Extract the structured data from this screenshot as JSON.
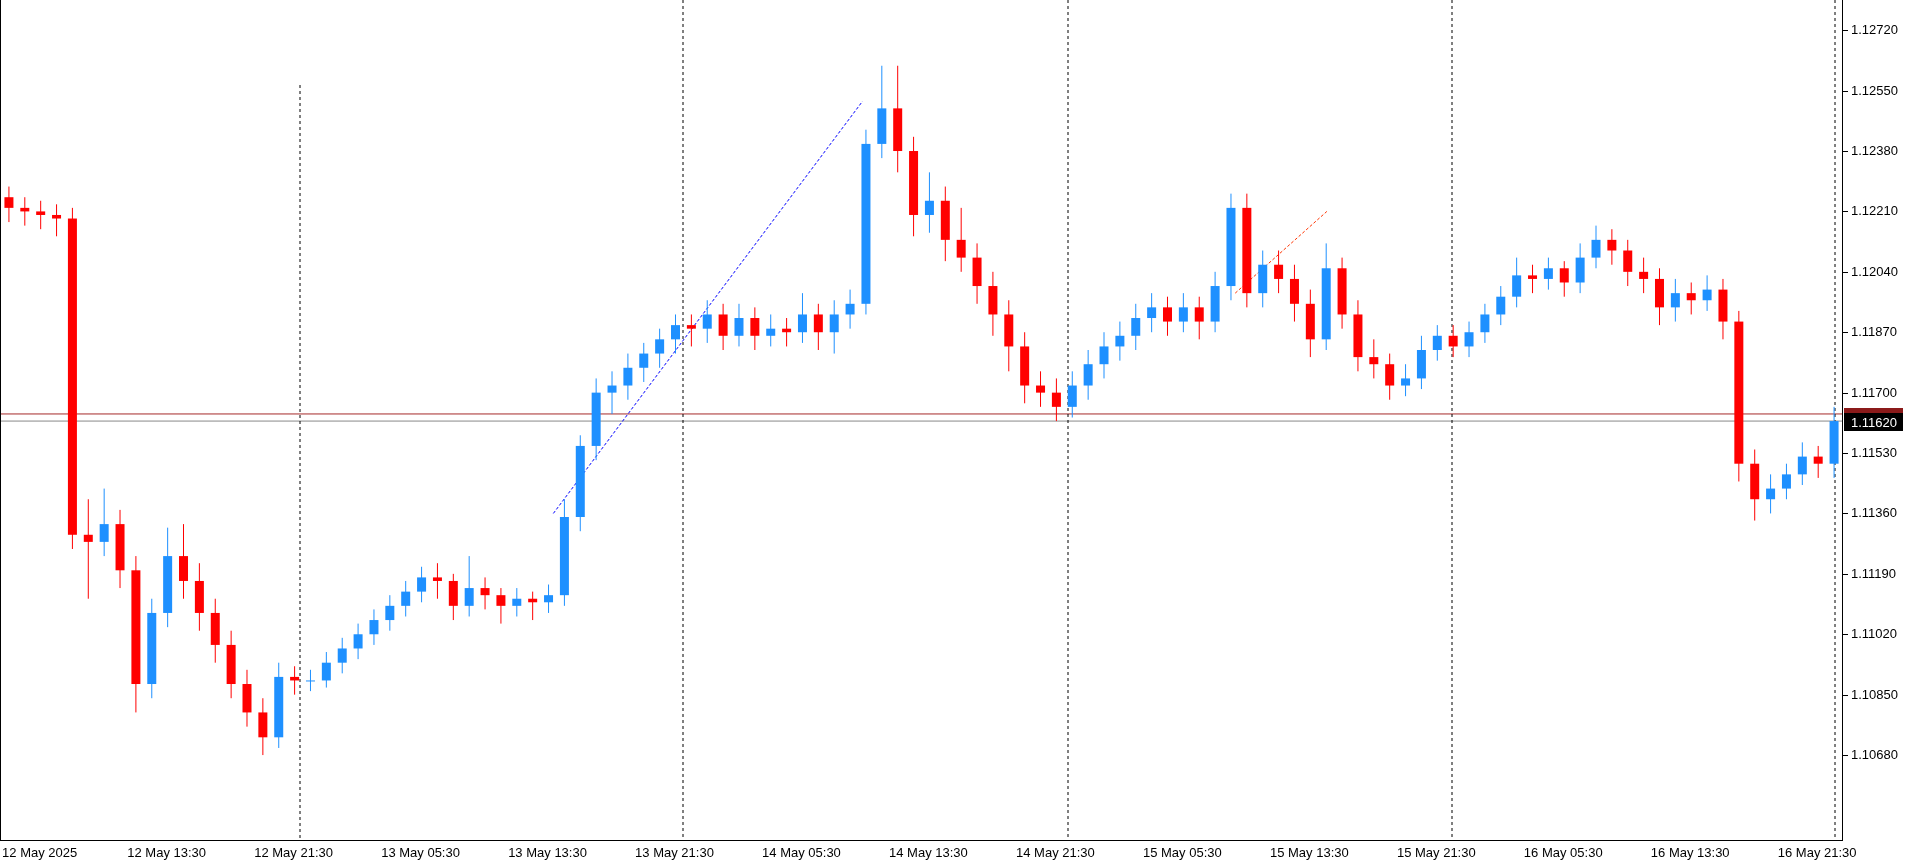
{
  "chart_data": {
    "type": "candlestick",
    "ylim": [
      1.10441,
      1.12805
    ],
    "categories": [
      null,
      null,
      "12 May 2025",
      null,
      null,
      null,
      null,
      null,
      null,
      null,
      "12 May 13:30",
      null,
      null,
      null,
      null,
      null,
      null,
      null,
      "12 May 21:30",
      null,
      null,
      null,
      null,
      null,
      null,
      null,
      "13 May 05:30",
      null,
      null,
      null,
      null,
      null,
      null,
      null,
      "13 May 13:30",
      null,
      null,
      null,
      null,
      null,
      null,
      null,
      "13 May 21:30",
      null,
      null,
      null,
      null,
      null,
      null,
      null,
      "14 May 05:30",
      null,
      null,
      null,
      null,
      null,
      null,
      null,
      "14 May 13:30",
      null,
      null,
      null,
      null,
      null,
      null,
      null,
      "14 May 21:30",
      null,
      null,
      null,
      null,
      null,
      null,
      null,
      "15 May 05:30",
      null,
      null,
      null,
      null,
      null,
      null,
      null,
      "15 May 13:30",
      null,
      null,
      null,
      null,
      null,
      null,
      null,
      "15 May 21:30",
      null,
      null,
      null,
      null,
      null,
      null,
      null,
      "16 May 05:30",
      null,
      null,
      null,
      null,
      null,
      null,
      null,
      "16 May 13:30",
      null,
      null,
      null,
      null,
      null,
      null,
      null,
      "16 May 21:30",
      null
    ],
    "ohlc": [
      [
        1.1225,
        1.1228,
        1.1218,
        1.1222
      ],
      [
        1.1222,
        1.1225,
        1.1217,
        1.1221
      ],
      [
        1.1221,
        1.1224,
        1.1216,
        1.122
      ],
      [
        1.122,
        1.1223,
        1.1214,
        1.1219
      ],
      [
        1.1219,
        1.1222,
        1.1126,
        1.113
      ],
      [
        1.113,
        1.114,
        1.1112,
        1.1128
      ],
      [
        1.1128,
        1.1143,
        1.1124,
        1.1133
      ],
      [
        1.1133,
        1.1137,
        1.1115,
        1.112
      ],
      [
        1.112,
        1.1124,
        1.108,
        1.1088
      ],
      [
        1.1088,
        1.1112,
        1.1084,
        1.1108
      ],
      [
        1.1108,
        1.1132,
        1.1104,
        1.1124
      ],
      [
        1.1124,
        1.1133,
        1.1112,
        1.1117
      ],
      [
        1.1117,
        1.1122,
        1.1103,
        1.1108
      ],
      [
        1.1108,
        1.1112,
        1.1094,
        1.1099
      ],
      [
        1.1099,
        1.1103,
        1.1084,
        1.1088
      ],
      [
        1.1088,
        1.1092,
        1.1076,
        1.108
      ],
      [
        1.108,
        1.1084,
        1.1068,
        1.1073
      ],
      [
        1.1073,
        1.1094,
        1.107,
        1.109
      ],
      [
        1.109,
        1.1093,
        1.1085,
        1.1089
      ],
      [
        1.1089,
        1.1092,
        1.1086,
        1.1089
      ],
      [
        1.1089,
        1.1097,
        1.1087,
        1.1094
      ],
      [
        1.1094,
        1.1101,
        1.1091,
        1.1098
      ],
      [
        1.1098,
        1.1105,
        1.1095,
        1.1102
      ],
      [
        1.1102,
        1.1109,
        1.1099,
        1.1106
      ],
      [
        1.1106,
        1.1113,
        1.1103,
        1.111
      ],
      [
        1.111,
        1.1117,
        1.1107,
        1.1114
      ],
      [
        1.1114,
        1.1121,
        1.1111,
        1.1118
      ],
      [
        1.1118,
        1.1122,
        1.1112,
        1.1117
      ],
      [
        1.1117,
        1.1119,
        1.1106,
        1.111
      ],
      [
        1.111,
        1.1124,
        1.1107,
        1.1115
      ],
      [
        1.1115,
        1.1118,
        1.1109,
        1.1113
      ],
      [
        1.1113,
        1.1115,
        1.1105,
        1.111
      ],
      [
        1.111,
        1.1115,
        1.1107,
        1.1112
      ],
      [
        1.1112,
        1.1114,
        1.1106,
        1.1111
      ],
      [
        1.1111,
        1.1116,
        1.1108,
        1.1113
      ],
      [
        1.1113,
        1.114,
        1.111,
        1.1135
      ],
      [
        1.1135,
        1.1158,
        1.1131,
        1.1155
      ],
      [
        1.1155,
        1.1174,
        1.1151,
        1.117
      ],
      [
        1.117,
        1.1176,
        1.1164,
        1.1172
      ],
      [
        1.1172,
        1.1181,
        1.1168,
        1.1177
      ],
      [
        1.1177,
        1.1184,
        1.1173,
        1.1181
      ],
      [
        1.1181,
        1.1188,
        1.1177,
        1.1185
      ],
      [
        1.1185,
        1.1192,
        1.1181,
        1.1189
      ],
      [
        1.1189,
        1.1192,
        1.1183,
        1.1188
      ],
      [
        1.1188,
        1.1196,
        1.1184,
        1.1192
      ],
      [
        1.1192,
        1.1195,
        1.1182,
        1.1186
      ],
      [
        1.1186,
        1.1195,
        1.1183,
        1.1191
      ],
      [
        1.1191,
        1.1194,
        1.1182,
        1.1186
      ],
      [
        1.1186,
        1.1192,
        1.1183,
        1.1188
      ],
      [
        1.1188,
        1.1191,
        1.1183,
        1.1187
      ],
      [
        1.1187,
        1.1198,
        1.1184,
        1.1192
      ],
      [
        1.1192,
        1.1195,
        1.1182,
        1.1187
      ],
      [
        1.1187,
        1.1196,
        1.1181,
        1.1192
      ],
      [
        1.1192,
        1.1199,
        1.1188,
        1.1195
      ],
      [
        1.1195,
        1.1244,
        1.1192,
        1.124
      ],
      [
        1.124,
        1.1262,
        1.1236,
        1.125
      ],
      [
        1.125,
        1.1262,
        1.1232,
        1.1238
      ],
      [
        1.1238,
        1.1242,
        1.1214,
        1.122
      ],
      [
        1.122,
        1.1232,
        1.1215,
        1.1224
      ],
      [
        1.1224,
        1.1228,
        1.1207,
        1.1213
      ],
      [
        1.1213,
        1.1222,
        1.1204,
        1.1208
      ],
      [
        1.1208,
        1.1212,
        1.1195,
        1.12
      ],
      [
        1.12,
        1.1204,
        1.1186,
        1.1192
      ],
      [
        1.1192,
        1.1196,
        1.1176,
        1.1183
      ],
      [
        1.1183,
        1.1187,
        1.1167,
        1.1172
      ],
      [
        1.1172,
        1.1176,
        1.1166,
        1.117
      ],
      [
        1.117,
        1.1174,
        1.1162,
        1.1166
      ],
      [
        1.1166,
        1.1176,
        1.1163,
        1.1172
      ],
      [
        1.1172,
        1.1182,
        1.1168,
        1.1178
      ],
      [
        1.1178,
        1.1187,
        1.1174,
        1.1183
      ],
      [
        1.1183,
        1.119,
        1.1179,
        1.1186
      ],
      [
        1.1186,
        1.1195,
        1.1182,
        1.1191
      ],
      [
        1.1191,
        1.1198,
        1.1187,
        1.1194
      ],
      [
        1.1194,
        1.1197,
        1.1186,
        1.119
      ],
      [
        1.119,
        1.1198,
        1.1187,
        1.1194
      ],
      [
        1.1194,
        1.1197,
        1.1185,
        1.119
      ],
      [
        1.119,
        1.1204,
        1.1187,
        1.12
      ],
      [
        1.12,
        1.1226,
        1.1196,
        1.1222
      ],
      [
        1.1222,
        1.1226,
        1.1194,
        1.1198
      ],
      [
        1.1198,
        1.121,
        1.1194,
        1.1206
      ],
      [
        1.1206,
        1.121,
        1.1198,
        1.1202
      ],
      [
        1.1202,
        1.1206,
        1.119,
        1.1195
      ],
      [
        1.1195,
        1.1199,
        1.118,
        1.1185
      ],
      [
        1.1185,
        1.1212,
        1.1182,
        1.1205
      ],
      [
        1.1205,
        1.1208,
        1.1188,
        1.1192
      ],
      [
        1.1192,
        1.1196,
        1.1176,
        1.118
      ],
      [
        1.118,
        1.1185,
        1.1174,
        1.1178
      ],
      [
        1.1178,
        1.1181,
        1.1168,
        1.1172
      ],
      [
        1.1172,
        1.1178,
        1.1169,
        1.1174
      ],
      [
        1.1174,
        1.1186,
        1.1171,
        1.1182
      ],
      [
        1.1182,
        1.1189,
        1.1179,
        1.1186
      ],
      [
        1.1186,
        1.1189,
        1.118,
        1.1183
      ],
      [
        1.1183,
        1.119,
        1.118,
        1.1187
      ],
      [
        1.1187,
        1.1195,
        1.1184,
        1.1192
      ],
      [
        1.1192,
        1.12,
        1.1189,
        1.1197
      ],
      [
        1.1197,
        1.1208,
        1.1194,
        1.1203
      ],
      [
        1.1203,
        1.1206,
        1.1198,
        1.1202
      ],
      [
        1.1202,
        1.1208,
        1.1199,
        1.1205
      ],
      [
        1.1205,
        1.1207,
        1.1197,
        1.1201
      ],
      [
        1.1201,
        1.1212,
        1.1198,
        1.1208
      ],
      [
        1.1208,
        1.1217,
        1.1205,
        1.1213
      ],
      [
        1.1213,
        1.1216,
        1.1206,
        1.121
      ],
      [
        1.121,
        1.1213,
        1.12,
        1.1204
      ],
      [
        1.1204,
        1.1208,
        1.1198,
        1.1202
      ],
      [
        1.1202,
        1.1205,
        1.1189,
        1.1194
      ],
      [
        1.1194,
        1.1202,
        1.119,
        1.1198
      ],
      [
        1.1198,
        1.1201,
        1.1192,
        1.1196
      ],
      [
        1.1196,
        1.1203,
        1.1193,
        1.1199
      ],
      [
        1.1199,
        1.1202,
        1.1185,
        1.119
      ],
      [
        1.119,
        1.1193,
        1.1145,
        1.115
      ],
      [
        1.115,
        1.1154,
        1.1134,
        1.114
      ],
      [
        1.114,
        1.1147,
        1.1136,
        1.1143
      ],
      [
        1.1143,
        1.115,
        1.114,
        1.1147
      ],
      [
        1.1147,
        1.1156,
        1.1144,
        1.1152
      ],
      [
        1.1152,
        1.1155,
        1.1146,
        1.115
      ],
      [
        1.115,
        1.1166,
        1.1146,
        1.1162
      ]
    ],
    "yticks": [
      {
        "value": 1.1272,
        "label": "1.12720"
      },
      {
        "value": 1.1255,
        "label": "1.12550"
      },
      {
        "value": 1.1238,
        "label": "1.12380"
      },
      {
        "value": 1.1221,
        "label": "1.12210"
      },
      {
        "value": 1.1204,
        "label": "1.12040"
      },
      {
        "value": 1.1187,
        "label": "1.11870"
      },
      {
        "value": 1.117,
        "label": "1.11700"
      },
      {
        "value": 1.1153,
        "label": "1.11530"
      },
      {
        "value": 1.1136,
        "label": "1.11360"
      },
      {
        "value": 1.1119,
        "label": "1.11190"
      },
      {
        "value": 1.1102,
        "label": "1.11020"
      },
      {
        "value": 1.1085,
        "label": "1.10850"
      },
      {
        "value": 1.1068,
        "label": "1.10680"
      }
    ]
  },
  "current_price": "1.11620"
}
